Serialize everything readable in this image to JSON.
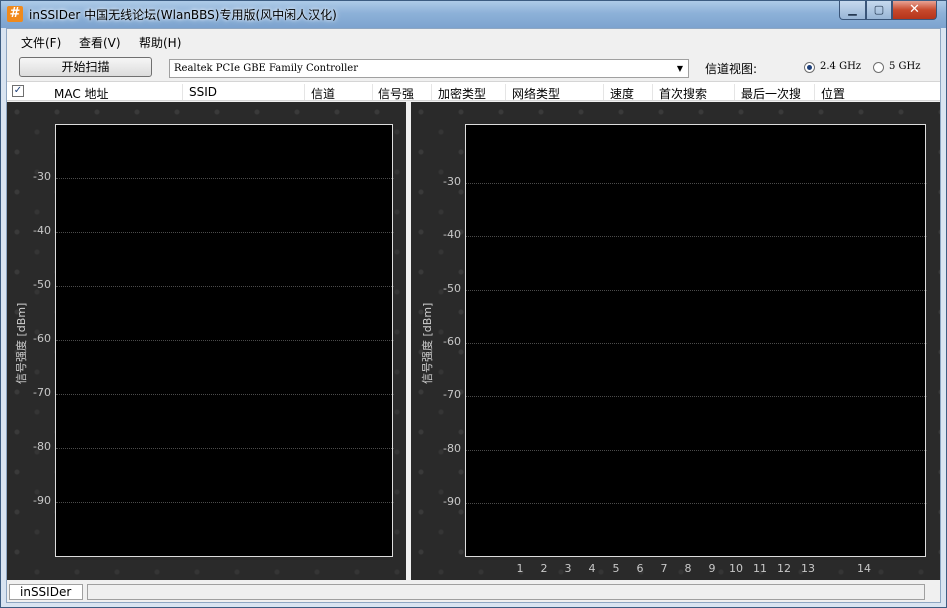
{
  "window": {
    "title": "inSSIDer 中国无线论坛(WlanBBS)专用版(风中闲人汉化)",
    "app_icon_glyph": "#",
    "controls": {
      "minimize": "▁",
      "maximize": "▢",
      "close": "✕"
    }
  },
  "menu": {
    "items": [
      "文件(F)",
      "查看(V)",
      "帮助(H)"
    ]
  },
  "toolbar": {
    "scan_label": "开始扫描",
    "adapter": "Realtek PCIe GBE Family Controller",
    "channel_view_label": "信道视图:",
    "band_options": [
      {
        "label": "2.4 GHz",
        "checked": true
      },
      {
        "label": "5 GHz",
        "checked": false
      }
    ]
  },
  "columns": [
    "MAC 地址",
    "SSID",
    "信道",
    "信号强",
    "加密类型",
    "网络类型",
    "速度",
    "首次搜索",
    "最后一次搜",
    "位置"
  ],
  "left_chart": {
    "ylabel": "信号强度 [dBm]",
    "yticks": [
      "-30",
      "-40",
      "-50",
      "-60",
      "-70",
      "-80",
      "-90"
    ]
  },
  "right_chart": {
    "ylabel": "信号强度 [dBm]",
    "yticks": [
      "-30",
      "-40",
      "-50",
      "-60",
      "-70",
      "-80",
      "-90"
    ],
    "xticks": [
      "1",
      "2",
      "3",
      "4",
      "5",
      "6",
      "7",
      "8",
      "9",
      "10",
      "11",
      "12",
      "13",
      "14"
    ]
  },
  "status": {
    "panel": "inSSIDer"
  },
  "colors": {
    "plot_bg": "#000000",
    "pane_bg": "#2a2a2a",
    "titlebar": "#8db1d8",
    "close": "#c7492c"
  }
}
